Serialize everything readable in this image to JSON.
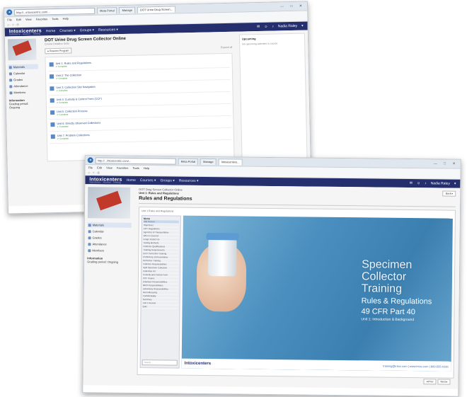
{
  "back_window": {
    "url": "http://...intoxicentric.com/...",
    "tabs": [
      "Meta Portal",
      "Manage",
      "DOT Urine Drug Screen..."
    ],
    "menu": [
      "File",
      "Edit",
      "View",
      "Favorites",
      "Tools",
      "Help"
    ],
    "logo": "Intoxicenters",
    "logo_sub": "Substance · Alcohol · Testing",
    "nav": [
      "Home",
      "Courses ▾",
      "Groups ▾",
      "Resources ▾"
    ],
    "user": "Nadia Raley",
    "course_title": "DOT Urine Drug Screen Collector Online",
    "course_sub": "Course Details ▸ Units",
    "resume_button": "▸ Resume Program",
    "expand_label": "Expand all",
    "upcoming_title": "Upcoming",
    "upcoming_text": "No upcoming activities in course",
    "sidebar": [
      {
        "label": "Materials",
        "selected": true
      },
      {
        "label": "Calendar",
        "selected": false
      },
      {
        "label": "Grades",
        "selected": false
      },
      {
        "label": "Attendance",
        "selected": false
      },
      {
        "label": "Members",
        "selected": false
      }
    ],
    "info_head": "Information",
    "info_text": "Grading period: Ongoing",
    "units": [
      {
        "title": "Unit 1: Rules and Regulations",
        "status": "✔ Complete"
      },
      {
        "title": "Unit 2: The Collection",
        "status": "✔ Complete"
      },
      {
        "title": "Unit 3: Collection Site Navigation",
        "status": "✔ Complete"
      },
      {
        "title": "Unit 4: Custody & Control Form (CCF)",
        "status": "✔ Complete"
      },
      {
        "title": "Unit 5: Collection Process",
        "status": "✔ Complete"
      },
      {
        "title": "Unit 6: Directly Observed Collections",
        "status": "✔ Complete"
      },
      {
        "title": "Unit 7: Problem Collections",
        "status": "✔ Complete"
      }
    ]
  },
  "front_window": {
    "url": "http://...intoxicentric.com/...",
    "tabs": [
      "Meta Portal",
      "Manage",
      "Intoxicenters..."
    ],
    "menu": [
      "File",
      "Edit",
      "View",
      "Favorites",
      "Tools",
      "Help"
    ],
    "logo": "Intoxicenters",
    "logo_sub": "Substance · Alcohol · Testing",
    "nav": [
      "Home",
      "Courses ▾",
      "Groups ▾",
      "Resources ▾"
    ],
    "user": "Nadia Raley",
    "crumb_course": "DOT Drug Screen Collector Online",
    "crumb_unit": "Unit 1: Rules and Regulations",
    "back_button": "Back ▸",
    "lesson_title": "Rules and Regulations",
    "player_header": "Unit 1 Rules and Regulations",
    "sidebar": [
      {
        "label": "Materials",
        "selected": true
      },
      {
        "label": "Calendar",
        "selected": false
      },
      {
        "label": "Grades",
        "selected": false
      },
      {
        "label": "Attendance",
        "selected": false
      },
      {
        "label": "Members",
        "selected": false
      }
    ],
    "info_head": "Information",
    "info_text": "Grading period: Ongoing",
    "menu_panel_title": "Menu",
    "menu_items": [
      "Title Screen",
      "Objectives",
      "DOT Regulations",
      "Agencies of Transportation",
      "Who is Covered",
      "Drugs Tested For",
      "Testing Methods",
      "Collector Qualifications",
      "Training Requirements",
      "Error Correction Training",
      "Proficiency Demonstration",
      "Refresher Training",
      "Collector Responsibilities",
      "Split Specimen Collection",
      "Collection Kit",
      "Custody and Control Form",
      "CCF Copies",
      "Employer Responsibilities",
      "MRO Responsibilities",
      "Laboratory Responsibilities",
      "Recordkeeping",
      "Confidentiality",
      "Summary",
      "Unit 1 Review",
      "Quiz"
    ],
    "menu_search": "Search...",
    "slide_line1": "Specimen",
    "slide_line2": "Collector Training",
    "slide_line3": "Rules & Regulations",
    "slide_line4": "49 CFR Part 40",
    "slide_line5": "Unit 1: Introduction & Background",
    "slide_footer_logo": "Intoxicenters",
    "slide_footer_contact": "training@intox.com  |  www.intox.com  |  800-555-0100",
    "prev_label": "◂ Prev",
    "next_label": "Next ▸"
  }
}
